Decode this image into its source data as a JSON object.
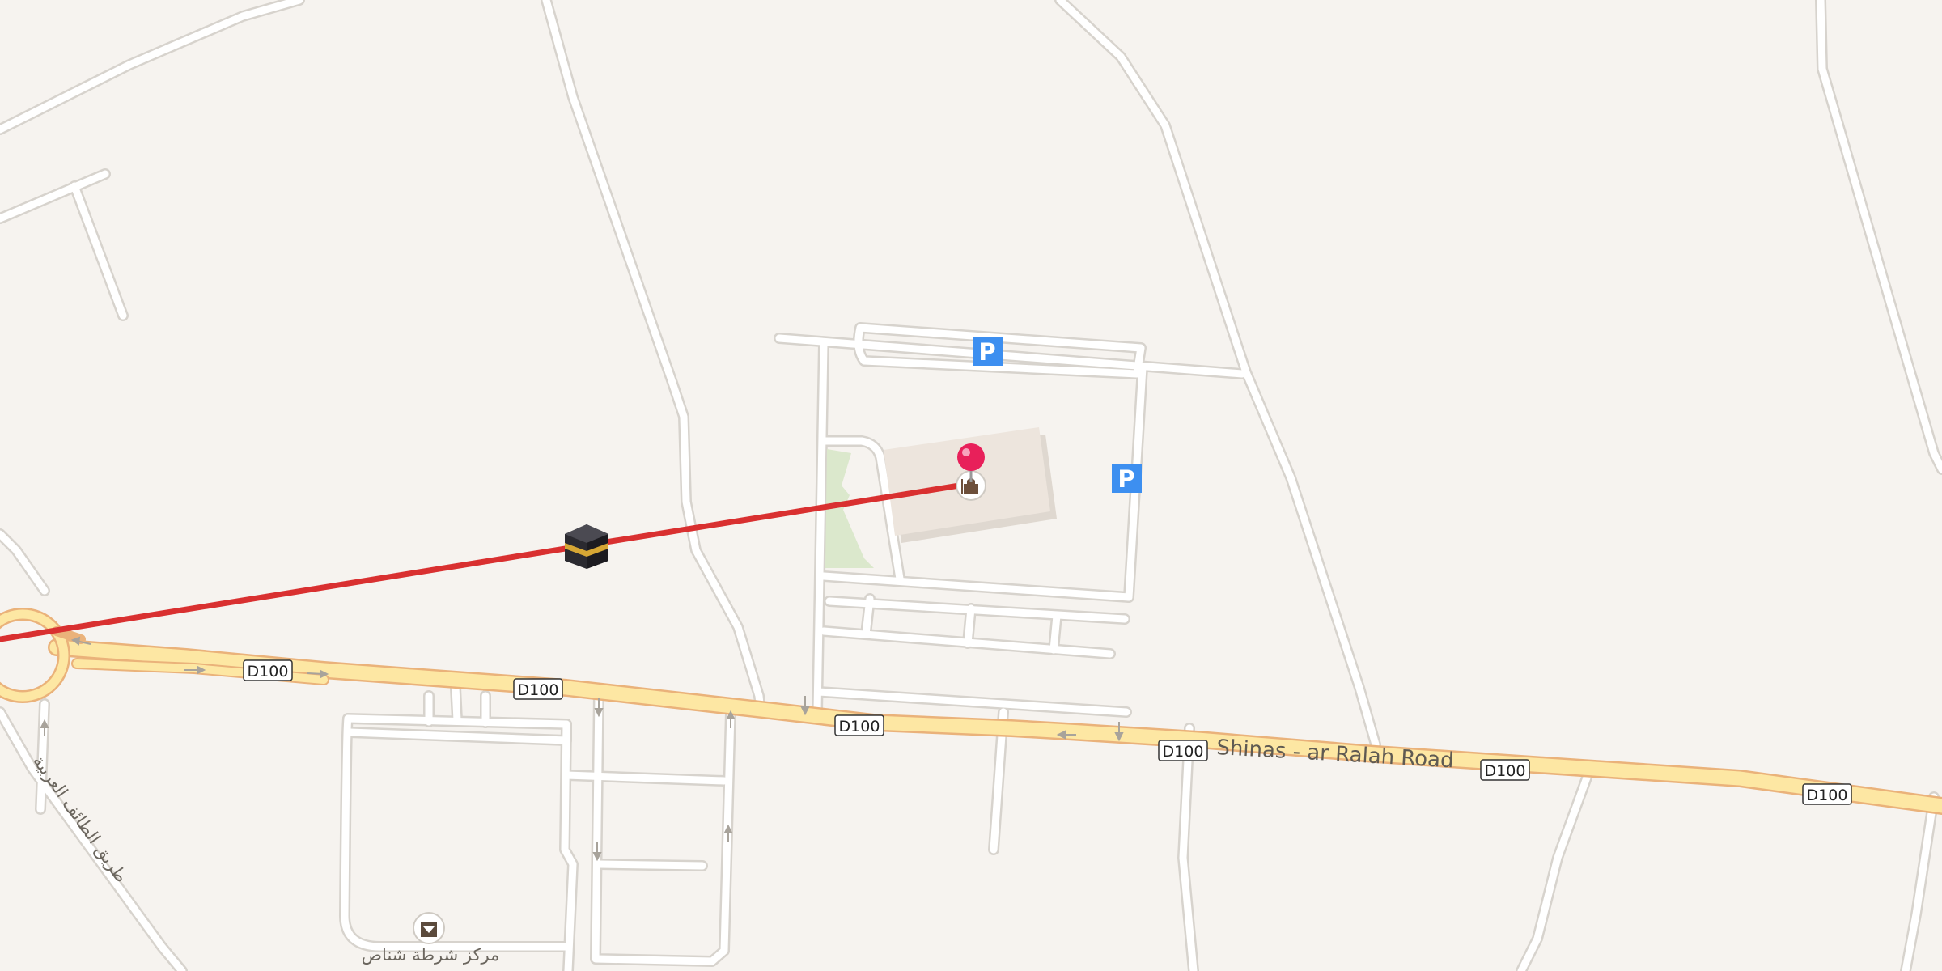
{
  "map": {
    "highway_shield": "D100",
    "main_road_name": "Shinas - ar Ralah Road",
    "arabic_road_label": "طريق الطائف العربية",
    "poi_label": "مركز شرطة شناص",
    "parking_symbol": "P",
    "colors": {
      "background": "#f6f3ef",
      "road_fill": "#fde7a3",
      "road_outline": "#eab27a",
      "minor_road": "#ffffff",
      "minor_road_outline": "#d7d3cd",
      "qibla_line": "#d93030",
      "pin": "#e8205a",
      "parking": "#3d8ff0",
      "park": "#dbe8cc",
      "building": "#ede5dd"
    },
    "icons": [
      "kaaba-icon",
      "location-pin-icon",
      "mosque-icon",
      "parking-icon",
      "police-station-icon"
    ]
  }
}
